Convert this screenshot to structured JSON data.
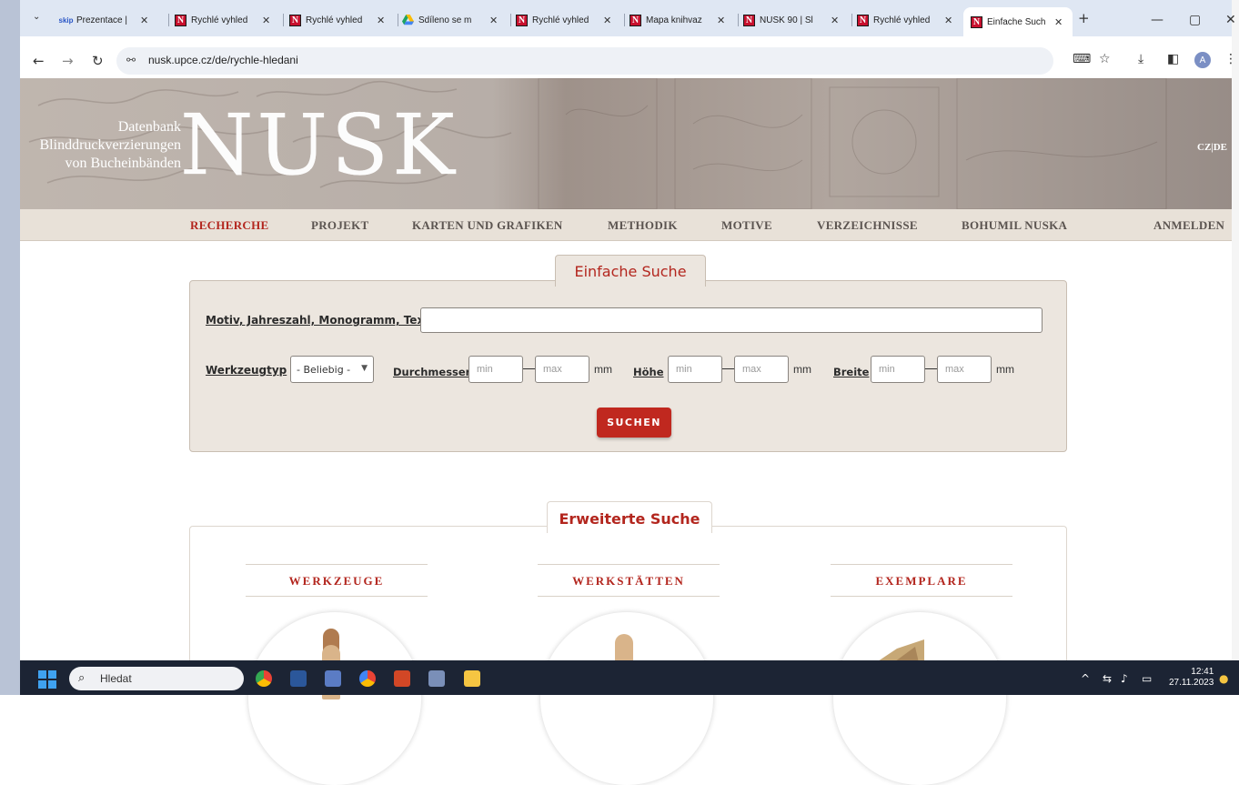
{
  "browser": {
    "tabs": [
      {
        "title": "Prezentace |",
        "favicon": "skip-favicon"
      },
      {
        "title": "Rychlé vyhled",
        "favicon": "nusk-favicon"
      },
      {
        "title": "Rychlé vyhled",
        "favicon": "nusk-favicon"
      },
      {
        "title": "Sdíleno se m",
        "favicon": "drive-favicon"
      },
      {
        "title": "Rychlé vyhled",
        "favicon": "nusk-favicon"
      },
      {
        "title": "Mapa knihvaz",
        "favicon": "nusk-favicon"
      },
      {
        "title": "NUSK 90 | Sl",
        "favicon": "nusk-favicon"
      },
      {
        "title": "Rychlé vyhled",
        "favicon": "nusk-favicon"
      },
      {
        "title": "Einfache Such",
        "favicon": "nusk-favicon",
        "active": true
      }
    ],
    "skip_favicon_text": "skip",
    "nusk_favicon_text": "N",
    "url": "nusk.upce.cz/de/rychle-hledani",
    "profile_initial": "A"
  },
  "site": {
    "banner_line1": "Datenbank",
    "banner_line2": "Blinddruckverzierungen",
    "banner_line3": "von Bucheinbänden",
    "logo": "NUSK",
    "lang_switch": "CZ|DE"
  },
  "nav": {
    "items": [
      "RECHERCHE",
      "PROJEKT",
      "KARTEN UND GRAFIKEN",
      "METHODIK",
      "MOTIVE",
      "VERZEICHNISSE",
      "BOHUMIL NUSKA",
      "ANMELDEN"
    ]
  },
  "simple_search": {
    "tab_label": "Einfache Suche",
    "motif_label": "Motiv, Jahreszahl, Monogramm, Text",
    "motif_value": "",
    "tool_type_label": "Werkzeugtyp",
    "tool_type_value": "- Beliebig -",
    "diameter_label": "Durchmesser",
    "height_label": "Höhe",
    "width_label": "Breite",
    "min_placeholder": "min",
    "max_placeholder": "max",
    "unit": "mm",
    "submit_label": "SUCHEN"
  },
  "extended_search": {
    "tab_label": "Erweiterte Suche",
    "categories": [
      "WERKZEUGE",
      "WERKSTÄTTEN",
      "EXEMPLARE"
    ]
  },
  "taskbar": {
    "search_text": "Hledat",
    "time": "12:41",
    "date": "27.11.2023"
  },
  "colors": {
    "accent": "#b3261e",
    "button": "#c0281f",
    "panel": "#ece6df",
    "nav_bg": "#e8e1d8"
  }
}
